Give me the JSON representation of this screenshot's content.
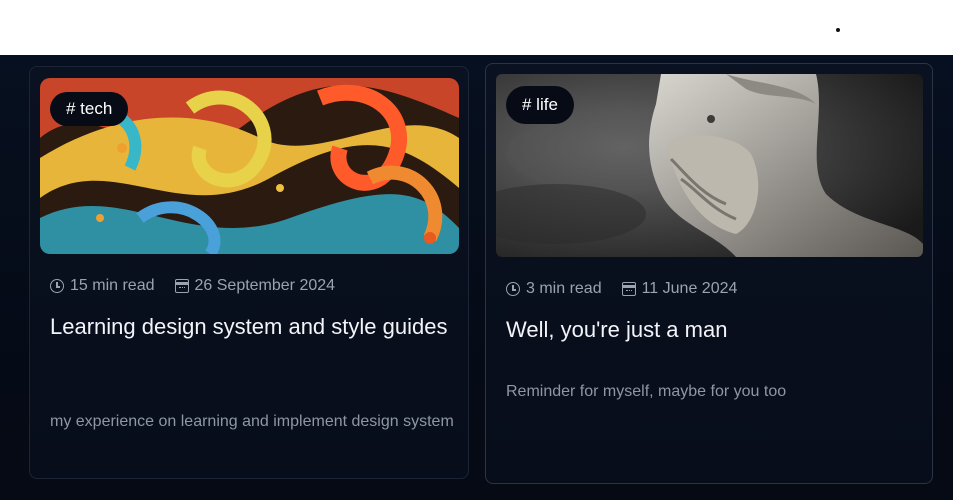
{
  "posts": [
    {
      "tag": "# tech",
      "read_time": "15 min read",
      "date": "26 September 2024",
      "title": "Learning design system and style guides",
      "description": "my experience on learning and implement design system",
      "thumbnail": "colorful-swirling-waves-artwork"
    },
    {
      "tag": "# life",
      "read_time": "3 min read",
      "date": "11 June 2024",
      "title": "Well, you're just a man",
      "description": "Reminder for myself, maybe for you too",
      "thumbnail": "marble-bearded-statue-artwork"
    }
  ],
  "icons": {
    "read_time": "alarm-clock-icon",
    "date": "calendar-icon"
  },
  "colors": {
    "background": "#060c18",
    "card": "#0a1120",
    "text": "#f2f4f8",
    "muted": "#9aa3b2"
  }
}
